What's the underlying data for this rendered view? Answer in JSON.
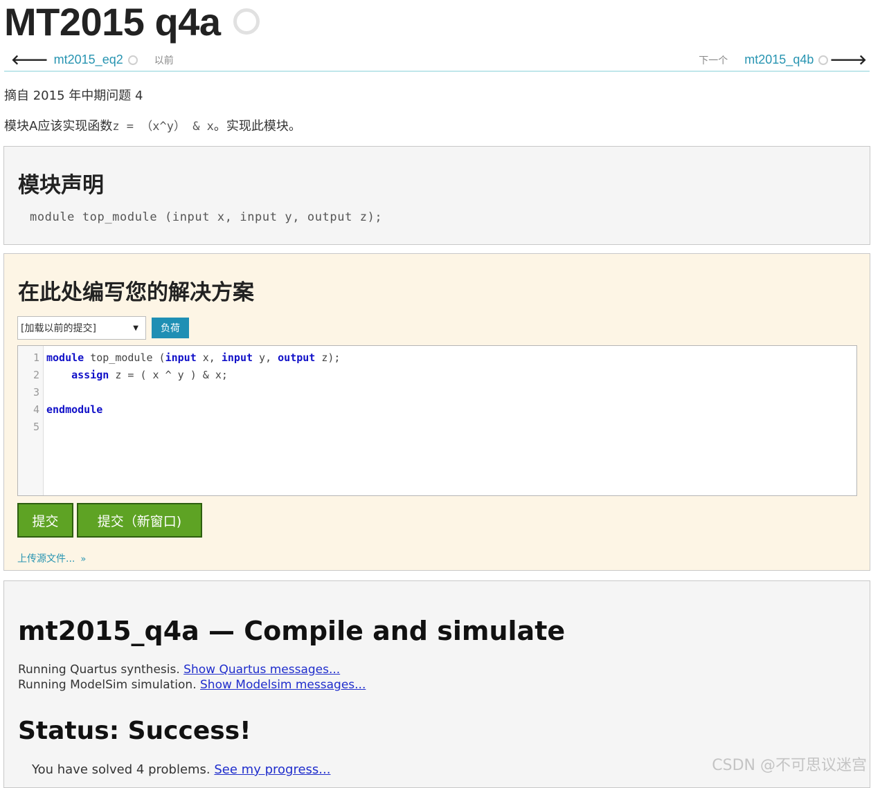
{
  "page": {
    "title": "MT2015 q4a"
  },
  "nav": {
    "prev_link": "mt2015_eq2",
    "prev_hint": "以前",
    "next_hint": "下一个",
    "next_link": "mt2015_q4b"
  },
  "intro": {
    "source": "摘自 2015 年中期问题 4",
    "desc_prefix": "模块A应该实现函数",
    "desc_formula": "z = （x^y） & x",
    "desc_suffix": "。实现此模块。"
  },
  "declaration": {
    "heading": "模块声明",
    "code": "module top_module (input x, input y, output z);"
  },
  "solution": {
    "heading": "在此处编写您的解决方案",
    "select_value": "[加载以前的提交]",
    "load_label": "负荷",
    "line_numbers": [
      "1",
      "2",
      "3",
      "4",
      "5"
    ],
    "code_lines": {
      "l1": {
        "kw1": "module",
        "t1": " top_module (",
        "kw2": "input",
        "t2": " x, ",
        "kw3": "input",
        "t3": " y, ",
        "kw4": "output",
        "t4": " z);"
      },
      "l2": {
        "indent": "    ",
        "kw": "assign",
        "rest": " z = ( x ^ y ) & x;"
      },
      "l4": {
        "kw": "endmodule"
      }
    },
    "submit_label": "提交",
    "submit_new_window_label": "提交（新窗口)",
    "upload_label": "上传源文件...",
    "upload_icon": "double-chevron-down"
  },
  "result": {
    "heading": "mt2015_q4a — Compile and simulate",
    "quartus_text": "Running Quartus synthesis. ",
    "quartus_link": "Show Quartus messages...",
    "modelsim_text": "Running ModelSim simulation. ",
    "modelsim_link": "Show Modelsim messages...",
    "status": "Status: Success!",
    "solved_text": "You have solved 4 problems. ",
    "progress_link": "See my progress..."
  },
  "watermark": "CSDN @不可思议迷宫",
  "colors": {
    "link": "#2794b1",
    "submit_green": "#5ea324",
    "load_blue": "#1e8fb4",
    "keyword_blue": "#1010c8",
    "solution_bg": "#fdf5e5"
  }
}
